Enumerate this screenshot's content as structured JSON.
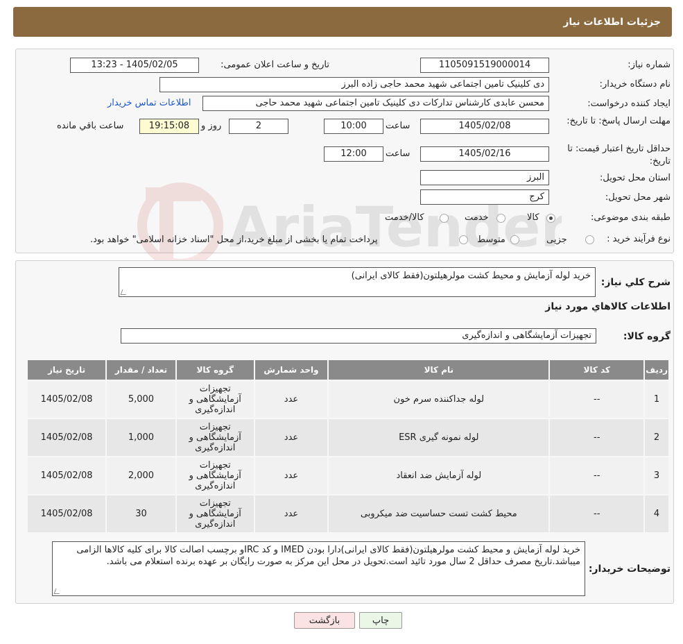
{
  "header": {
    "title": "جزئیات اطلاعات نیاز"
  },
  "fields": {
    "need_number_label": "شماره نیاز:",
    "need_number": "1105091519000014",
    "announce_label": "تاریخ و ساعت اعلان عمومی:",
    "announce_value": "1405/02/05 - 13:23",
    "buyer_org_label": "نام دستگاه خریدار:",
    "buyer_org": "دی کلینیک تامین اجتماعی شهید محمد حاجی زاده البرز",
    "creator_label": "ایجاد کننده درخواست:",
    "creator": "محسن عابدی کارشناس تدارکات دی کلینیک تامین اجتماعی شهید محمد حاجی",
    "contact_link": "اطلاعات تماس خریدار",
    "deadline_label": "مهلت ارسال پاسخ: تا تاریخ:",
    "deadline_date": "1405/02/08",
    "time_label": "ساعت",
    "deadline_time": "10:00",
    "days_value": "2",
    "days_label": "روز و",
    "remaining_time": "19:15:08",
    "remaining_label": "ساعت باقي مانده",
    "validity_label": "حداقل تاریخ اعتبار قیمت: تا تاریخ:",
    "validity_date": "1405/02/16",
    "validity_time": "12:00",
    "province_label": "استان محل تحویل:",
    "province": "البرز",
    "city_label": "شهر محل تحویل:",
    "city": "کرج",
    "category_label": "طبقه بندی موضوعی:",
    "category_options": [
      "کالا",
      "خدمت",
      "کالا/خدمت"
    ],
    "process_label": "نوع فرآیند خرید :",
    "process_options": [
      "جزیی",
      "متوسط"
    ],
    "process_note": "پرداخت تمام یا بخشی از مبلغ خرید،از محل \"اسناد خزانه اسلامی\" خواهد بود."
  },
  "summary": {
    "label": "شرح كلي نياز:",
    "text": "خرید لوله آزمایش و محیط کشت مولرهیلتون(فقط کالای ایرانی)",
    "goods_info_title": "اطلاعات كالاهاي مورد نياز",
    "group_label": "گروه کالا:",
    "group_value": "تجهیزات آزمایشگاهی و اندازه‌گیری"
  },
  "table": {
    "headers": [
      "ردیف",
      "کد کالا",
      "نام کالا",
      "واحد شمارش",
      "گروه کالا",
      "تعداد / مقدار",
      "تاریخ نیاز"
    ],
    "rows": [
      [
        "1",
        "--",
        "لوله جداکننده سرم خون",
        "عدد",
        "تجهیزات آزمایشگاهی و اندازه‌گیری",
        "5,000",
        "1405/02/08"
      ],
      [
        "2",
        "--",
        "لوله نمونه گیری ESR",
        "عدد",
        "تجهیزات آزمایشگاهی و اندازه‌گیری",
        "1,000",
        "1405/02/08"
      ],
      [
        "3",
        "--",
        "لوله آزمایش ضد انعقاد",
        "عدد",
        "تجهیزات آزمایشگاهی و اندازه‌گیری",
        "2,000",
        "1405/02/08"
      ],
      [
        "4",
        "--",
        "محیط کشت تست حساسیت ضد میکروبی",
        "عدد",
        "تجهیزات آزمایشگاهی و اندازه‌گیری",
        "30",
        "1405/02/08"
      ]
    ]
  },
  "buyer_notes": {
    "label": "توضیحات خریدار:",
    "text": "خرید لوله آزمایش و محیط کشت مولرهیلتون(فقط کالای ایرانی)دارا بودن IMED و کد IRCو برچسب اصالت کالا برای کلیه کالاها الزامی میباشد.تاریخ مصرف حداقل 2 سال مورد تائید است.تحویل در محل این مرکز به صورت رایگان بر عهده برنده استعلام می باشد."
  },
  "buttons": {
    "print": "چاپ",
    "back": "بازگشت"
  },
  "colors": {
    "header_bg": "#8c6a3f",
    "table_header_bg": "#8a8a8a",
    "back_button_bg": "#fbe3e3",
    "print_button_bg": "#eaf7e6"
  }
}
